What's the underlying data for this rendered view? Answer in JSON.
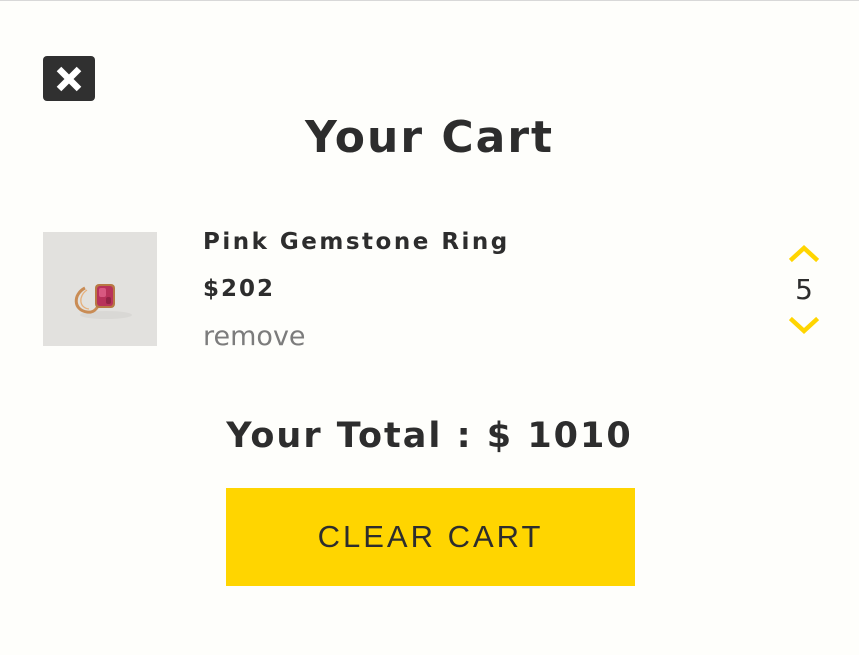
{
  "cart": {
    "title": "Your Cart",
    "close_icon": "close-x-icon"
  },
  "items": [
    {
      "name": "Pink Gemstone Ring",
      "price": "$202",
      "remove_label": "remove",
      "quantity": "5",
      "image": "pink-gemstone-ring-photo",
      "increase_icon": "chevron-up-icon",
      "decrease_icon": "chevron-down-icon"
    }
  ],
  "total": {
    "label": "Your Total : $ ",
    "amount": "1010"
  },
  "actions": {
    "clear_label": "CLEAR CART"
  },
  "colors": {
    "accent": "#ffd500",
    "text": "#2d2d2d",
    "muted": "#7c7c7c",
    "close_bg": "#303030",
    "background": "#fefefb"
  }
}
